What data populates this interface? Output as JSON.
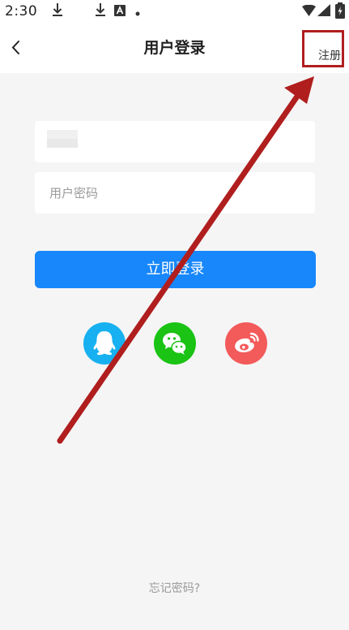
{
  "status_bar": {
    "time": "2:30"
  },
  "header": {
    "title": "用户登录",
    "register_label": "注册"
  },
  "login_form": {
    "password_placeholder": "用户密码",
    "login_label": "立即登录",
    "forgot_password_label": "忘记密码?"
  },
  "colors": {
    "primary": "#1787fb",
    "qq": "#17b0f0",
    "wechat": "#1ac314",
    "weibo": "#f35a5a",
    "annotation": "#b01e1e"
  },
  "icons": [
    "back-icon",
    "download-icon",
    "a-icon",
    "wifi-icon",
    "signal-icon",
    "battery-icon",
    "qq-icon",
    "wechat-icon",
    "weibo-icon"
  ]
}
